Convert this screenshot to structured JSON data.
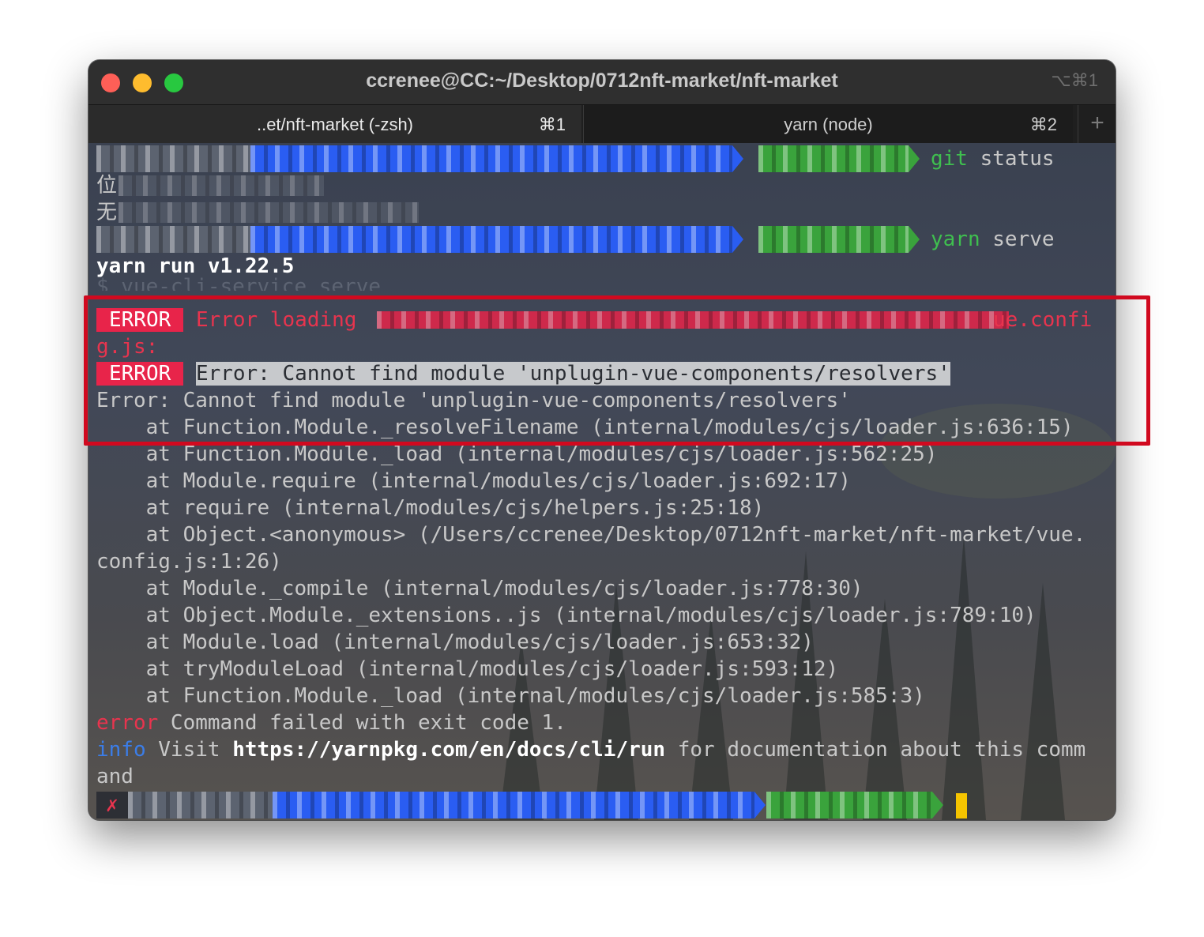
{
  "window": {
    "title": "ccrenee@CC:~/Desktop/0712nft-market/nft-market",
    "shortcut": "⌥⌘1"
  },
  "tabs": [
    {
      "label": "..et/nft-market (-zsh)",
      "shortcut": "⌘1"
    },
    {
      "label": "yarn (node)",
      "shortcut": "⌘2"
    }
  ],
  "new_tab_label": "+",
  "terminal": {
    "prompt1_cmd_a": "git",
    "prompt1_cmd_b": "status",
    "git_status_line1_start": "位",
    "git_status_line2_start": "无",
    "prompt2_cmd_a": "yarn",
    "prompt2_cmd_b": "serve",
    "yarn_version": "yarn run v1.22.5",
    "vue_cli_cmd": "$ vue-cli-service serve",
    "error_badge": "ERROR",
    "error_loading": "Error loading",
    "error_loading_tail": "ue.confi",
    "error_loading_wrap": "g.js:",
    "error2_badge": "ERROR",
    "error2_msg": "Error: Cannot find module 'unplugin-vue-components/resolvers'",
    "error3": "Error: Cannot find module 'unplugin-vue-components/resolvers'",
    "stack": [
      "    at Function.Module._resolveFilename (internal/modules/cjs/loader.js:636:15)",
      "    at Function.Module._load (internal/modules/cjs/loader.js:562:25)",
      "    at Module.require (internal/modules/cjs/loader.js:692:17)",
      "    at require (internal/modules/cjs/helpers.js:25:18)",
      "    at Object.<anonymous> (/Users/ccrenee/Desktop/0712nft-market/nft-market/vue.",
      "config.js:1:26)",
      "    at Module._compile (internal/modules/cjs/loader.js:778:30)",
      "    at Object.Module._extensions..js (internal/modules/cjs/loader.js:789:10)",
      "    at Module.load (internal/modules/cjs/loader.js:653:32)",
      "    at tryModuleLoad (internal/modules/cjs/loader.js:593:12)",
      "    at Function.Module._load (internal/modules/cjs/loader.js:585:3)"
    ],
    "fail_prefix": "error",
    "fail_msg": " Command failed with exit code 1.",
    "info_prefix": "info",
    "info_visit": " Visit ",
    "info_url": "https://yarnpkg.com/en/docs/cli/run",
    "info_tail": " for documentation about this comm",
    "info_wrap": "and",
    "last_prompt_status": "✗"
  },
  "colors": {
    "prompt_blue": "#2a5df2",
    "prompt_green": "#3aa33c",
    "error_red": "#e8244a",
    "highlight_box": "#d1091f",
    "cursor": "#f5c400"
  }
}
